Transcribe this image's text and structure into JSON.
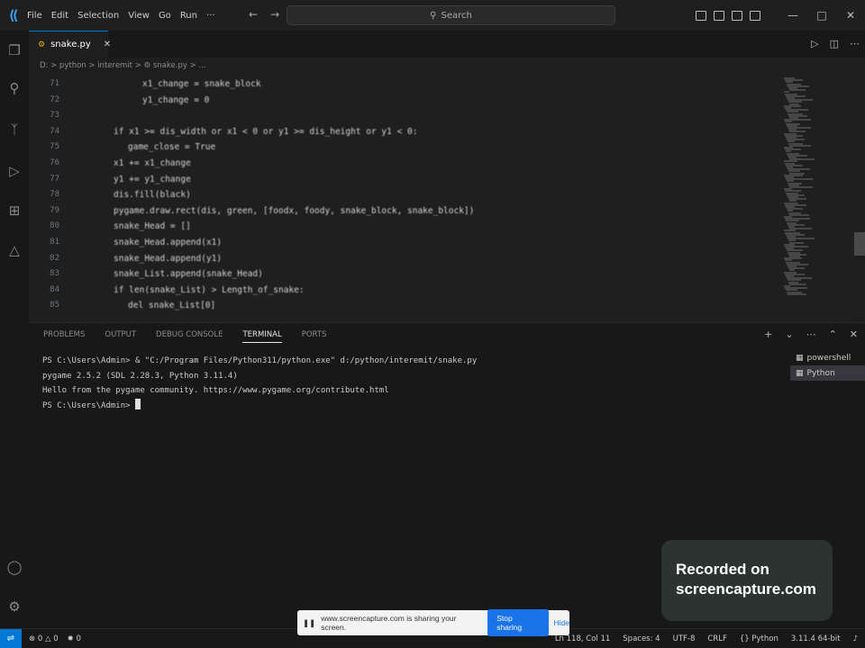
{
  "titlebar": {
    "menu": [
      "File",
      "Edit",
      "Selection",
      "View",
      "Go",
      "Run",
      "···"
    ],
    "search_placeholder": "Search"
  },
  "editor": {
    "tab_label": "snake.py",
    "breadcrumb": "D: > python > interemit > ⚙ snake.py > ...",
    "lines": [
      {
        "num": "71",
        "indent": 8,
        "text": "x1_change = snake_block"
      },
      {
        "num": "72",
        "indent": 8,
        "text": "y1_change = 0"
      },
      {
        "num": "73",
        "indent": 0,
        "text": ""
      },
      {
        "num": "74",
        "indent": 4,
        "text": "if x1 >= dis_width or x1 < 0 or y1 >= dis_height or y1 < 0:"
      },
      {
        "num": "75",
        "indent": 6,
        "text": "game_close = True"
      },
      {
        "num": "76",
        "indent": 4,
        "text": "x1 += x1_change"
      },
      {
        "num": "77",
        "indent": 4,
        "text": "y1 += y1_change"
      },
      {
        "num": "78",
        "indent": 4,
        "text": "dis.fill(black)"
      },
      {
        "num": "79",
        "indent": 4,
        "text": "pygame.draw.rect(dis, green, [foodx, foody, snake_block, snake_block])"
      },
      {
        "num": "80",
        "indent": 4,
        "text": "snake_Head = []"
      },
      {
        "num": "81",
        "indent": 4,
        "text": "snake_Head.append(x1)"
      },
      {
        "num": "82",
        "indent": 4,
        "text": "snake_Head.append(y1)"
      },
      {
        "num": "83",
        "indent": 4,
        "text": "snake_List.append(snake_Head)"
      },
      {
        "num": "84",
        "indent": 4,
        "text": "if len(snake_List) > Length_of_snake:"
      },
      {
        "num": "85",
        "indent": 6,
        "text": "del snake_List[0]"
      }
    ]
  },
  "panel": {
    "tabs": [
      "PROBLEMS",
      "OUTPUT",
      "DEBUG CONSOLE",
      "TERMINAL",
      "PORTS"
    ],
    "active_tab": "TERMINAL",
    "terminal_lines": [
      "PS C:\\Users\\Admin> & \"C:/Program Files/Python311/python.exe\" d:/python/interemit/snake.py",
      "pygame 2.5.2 (SDL 2.28.3, Python 3.11.4)",
      "Hello from the pygame community. https://www.pygame.org/contribute.html",
      "PS C:\\Users\\Admin> "
    ],
    "terminals": [
      "powershell",
      "Python"
    ]
  },
  "statusbar": {
    "errors": "0",
    "warnings": "0",
    "ports": "0",
    "position": "Ln 118, Col 11",
    "spaces": "Spaces: 4",
    "encoding": "UTF-8",
    "eol": "CRLF",
    "language": "Python",
    "interpreter": "3.11.4 64-bit"
  },
  "recording": {
    "card_line1": "Recorded on",
    "card_line2": "screencapture.com",
    "share_text": "www.screencapture.com is sharing your screen.",
    "stop_label": "Stop sharing",
    "hide_label": "Hide"
  },
  "colors": {
    "accent": "#0078d4",
    "editor_bg": "#1f1f1f",
    "panel_bg": "#181818"
  }
}
